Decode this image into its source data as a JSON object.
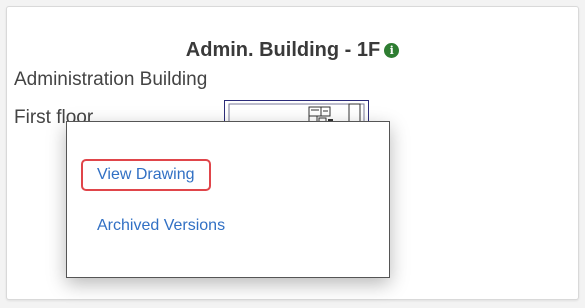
{
  "header": {
    "title": "Admin. Building - 1F",
    "info_icon": "info-icon"
  },
  "details": {
    "building": "Administration Building",
    "floor": "First floor"
  },
  "menu": {
    "items": [
      {
        "label": "View Drawing",
        "highlighted": true
      },
      {
        "label": "Archived Versions"
      }
    ]
  },
  "colors": {
    "link": "#3170c4",
    "highlight_border": "#e0454a",
    "info_icon": "#2e7d32"
  }
}
